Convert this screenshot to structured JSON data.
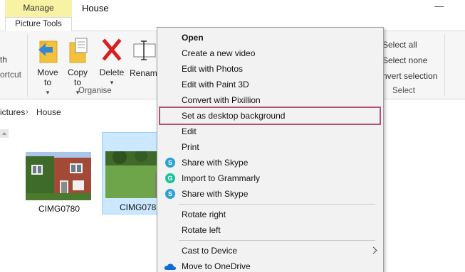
{
  "window": {
    "title": "House",
    "context_tab": "Manage",
    "tool_tab": "Picture Tools"
  },
  "ribbon": {
    "left_partial": [
      "th",
      "ortcut"
    ],
    "move_to": "Move to",
    "copy_to": "Copy to",
    "delete": "Delete",
    "rename": "Rename",
    "organise_label": "Organise",
    "select_all": "Select all",
    "select_none": "Select none",
    "invert_selection": "nvert selection",
    "select_label": "Select",
    "colors": {
      "delete_red": "#d81e1e",
      "folder_yellow": "#f4c13d",
      "arrow_blue": "#3a86d6"
    }
  },
  "address": {
    "crumbs": [
      "ictures",
      "House"
    ]
  },
  "files": [
    {
      "name": "CIMG0780",
      "selected": false
    },
    {
      "name": "CIMG0781",
      "selected": true
    }
  ],
  "context_menu": {
    "items": [
      {
        "label": "Open",
        "bold": true,
        "icon": null
      },
      {
        "label": "Create a new video",
        "icon": null
      },
      {
        "label": "Edit with Photos",
        "icon": null
      },
      {
        "label": "Edit with Paint 3D",
        "icon": null
      },
      {
        "label": "Convert with Pixillion",
        "icon": null
      },
      {
        "label": "Set as desktop background",
        "highlighted": true,
        "icon": null
      },
      {
        "label": "Edit",
        "icon": null
      },
      {
        "label": "Print",
        "icon": null
      },
      {
        "label": "Share with Skype",
        "icon": "skype-icon",
        "icon_color": "#2a9fd8",
        "icon_glyph": "S"
      },
      {
        "label": "Import to Grammarly",
        "icon": "grammarly-icon",
        "icon_color": "#15c39a",
        "icon_glyph": "G"
      },
      {
        "label": "Share with Skype",
        "icon": "skype-icon",
        "icon_color": "#2a9fd8",
        "icon_glyph": "S"
      },
      {
        "label": "Rotate right",
        "icon": null
      },
      {
        "label": "Rotate left",
        "icon": null
      },
      {
        "label": "Cast to Device",
        "icon": null,
        "submenu": true
      },
      {
        "label": "Move to OneDrive",
        "icon": "onedrive-icon",
        "icon_color": "#0f6cd4"
      }
    ],
    "highlight_color": "#b5527a"
  }
}
